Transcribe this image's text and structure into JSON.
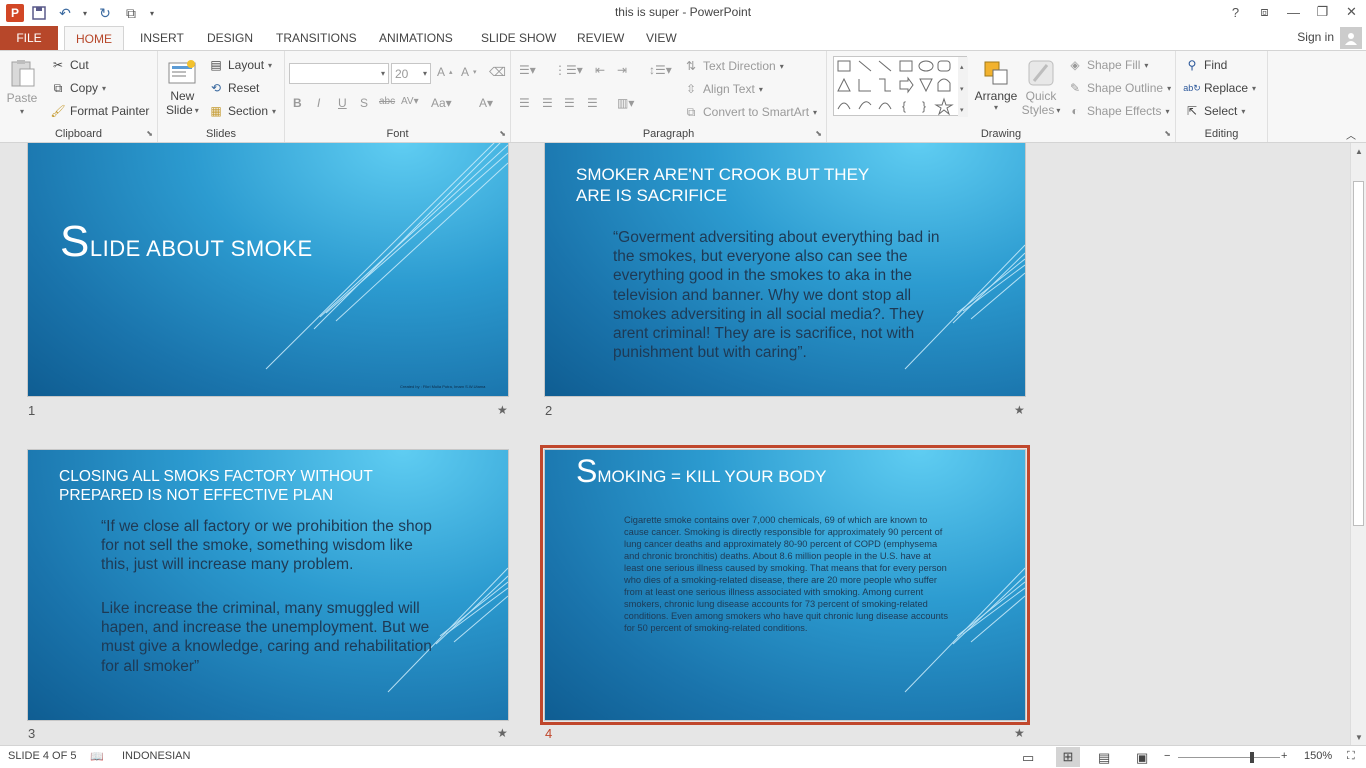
{
  "app": {
    "title": "this is super - PowerPoint",
    "help": "?",
    "signin": "Sign in"
  },
  "tabs": [
    "FILE",
    "HOME",
    "INSERT",
    "DESIGN",
    "TRANSITIONS",
    "ANIMATIONS",
    "SLIDE SHOW",
    "REVIEW",
    "VIEW"
  ],
  "ribbon": {
    "clipboard": {
      "label": "Clipboard",
      "paste": "Paste",
      "cut": "Cut",
      "copy": "Copy",
      "format_painter": "Format Painter"
    },
    "slides": {
      "label": "Slides",
      "new_slide_line1": "New",
      "new_slide_line2": "Slide",
      "layout": "Layout",
      "reset": "Reset",
      "section": "Section"
    },
    "font": {
      "label": "Font",
      "font_name": "",
      "font_size": "20"
    },
    "paragraph": {
      "label": "Paragraph",
      "text_direction": "Text Direction",
      "align_text": "Align Text",
      "convert_smartart": "Convert to SmartArt"
    },
    "drawing": {
      "label": "Drawing",
      "arrange": "Arrange",
      "quick_styles_line1": "Quick",
      "quick_styles_line2": "Styles",
      "shape_fill": "Shape Fill",
      "shape_outline": "Shape Outline",
      "shape_effects": "Shape Effects"
    },
    "editing": {
      "label": "Editing",
      "find": "Find",
      "replace": "Replace",
      "select": "Select"
    }
  },
  "slides": [
    {
      "number": "1",
      "title_initial": "S",
      "title_rest": "LIDE ABOUT SMOKE",
      "footer": "Created by : Fikri Mulia Putra, Imam S.W.Utama"
    },
    {
      "number": "2",
      "title_line1": "SMOKER ARE'NT CROOK BUT THEY",
      "title_line2": "ARE IS SACRIFICE",
      "body": "“Goverment adversiting about everything bad in the smokes, but everyone also can see the everything good in the smokes to aka in the television and banner. Why we dont stop all smokes adversiting in all social media?. They arent criminal! They are is sacrifice, not with punishment but with caring”."
    },
    {
      "number": "3",
      "title_line1": "CLOSING ALL SMOKS FACTORY WITHOUT",
      "title_line2": "PREPARED IS NOT EFFECTIVE PLAN",
      "body1": "“If we close all factory or we prohibition the shop for not sell the smoke, something wisdom like this, just will increase many problem.",
      "body2": "Like increase the criminal, many smuggled will hapen, and increase the unemployment. But we must give a knowledge, caring and rehabilitation for all smoker”"
    },
    {
      "number": "4",
      "title_initial": "S",
      "title_rest": "MOKING = KILL YOUR BODY",
      "body": "Cigarette smoke contains over 7,000 chemicals, 69 of which are known to cause cancer.  Smoking is directly responsible for approximately 90 percent of lung cancer deaths and approximately 80-90 percent of COPD (emphysema and chronic bronchitis) deaths. About 8.6 million people in the U.S. have at least one serious illness caused by smoking. That means that for every person who dies of a smoking-related disease, there are 20 more people who suffer from at least one serious illness associated with smoking. Among current smokers, chronic lung disease accounts for 73 percent of smoking-related conditions. Even among smokers who have quit chronic lung disease accounts for 50 percent of smoking-related conditions."
    }
  ],
  "slide_star": "★",
  "status": {
    "slide_of": "SLIDE 4 OF 5",
    "language": "INDONESIAN",
    "zoom": "150%"
  },
  "colors": {
    "file_tab": "#b7472a",
    "accent": "#c0472c",
    "slide_bg": "#1a74ac"
  }
}
